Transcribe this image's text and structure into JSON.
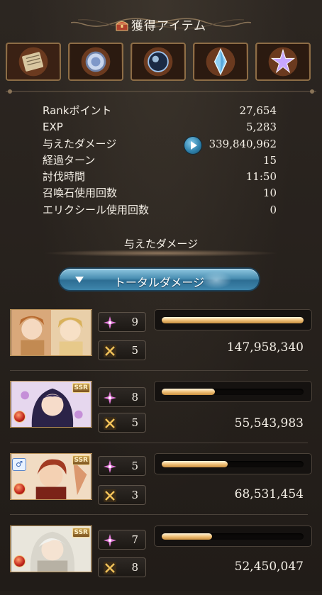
{
  "header": {
    "title": "獲得アイテム",
    "chest_icon": "treasure-chest-icon"
  },
  "items": [
    {
      "name": "scroll-item-icon",
      "color": "#c9b38a"
    },
    {
      "name": "silver-orb-item-icon",
      "color": "#9fb4d8"
    },
    {
      "name": "dark-orb-item-icon",
      "color": "#7aa6d6"
    },
    {
      "name": "blue-crystal-item-icon",
      "color": "#8fd0f5"
    },
    {
      "name": "star-gem-item-icon",
      "color": "#c7a6ff"
    }
  ],
  "stats": {
    "rank_points_label": "Rankポイント",
    "rank_points": "27,654",
    "exp_label": "EXP",
    "exp": "5,283",
    "damage_label": "与えたダメージ",
    "damage": "339,840,962",
    "turns_label": "経過ターン",
    "turns": "15",
    "time_label": "討伐時間",
    "time": "11:50",
    "summons_label": "召喚石使用回数",
    "summons": "10",
    "elixir_label": "エリクシール使用回数",
    "elixir": "0"
  },
  "damage_section": {
    "title": "与えたダメージ",
    "dropdown_label": "トータルダメージ"
  },
  "characters": [
    {
      "skills": "9",
      "attacks": "5",
      "damage": "147,958,340",
      "bar_fraction": 1.0,
      "ssr": "",
      "fire": false,
      "slot_badge": ""
    },
    {
      "skills": "8",
      "attacks": "5",
      "damage": "55,543,983",
      "bar_fraction": 0.375,
      "ssr": "SSR",
      "fire": true,
      "slot_badge": ""
    },
    {
      "skills": "5",
      "attacks": "3",
      "damage": "68,531,454",
      "bar_fraction": 0.463,
      "ssr": "SSR",
      "fire": true,
      "slot_badge": "♂"
    },
    {
      "skills": "7",
      "attacks": "8",
      "damage": "52,450,047",
      "bar_fraction": 0.355,
      "ssr": "SSR",
      "fire": true,
      "slot_badge": ""
    }
  ],
  "colors": {
    "accent_blue": "#4a8fb2",
    "bar_gold": "#f1c27a",
    "skill_pink": "#e27ad9"
  }
}
